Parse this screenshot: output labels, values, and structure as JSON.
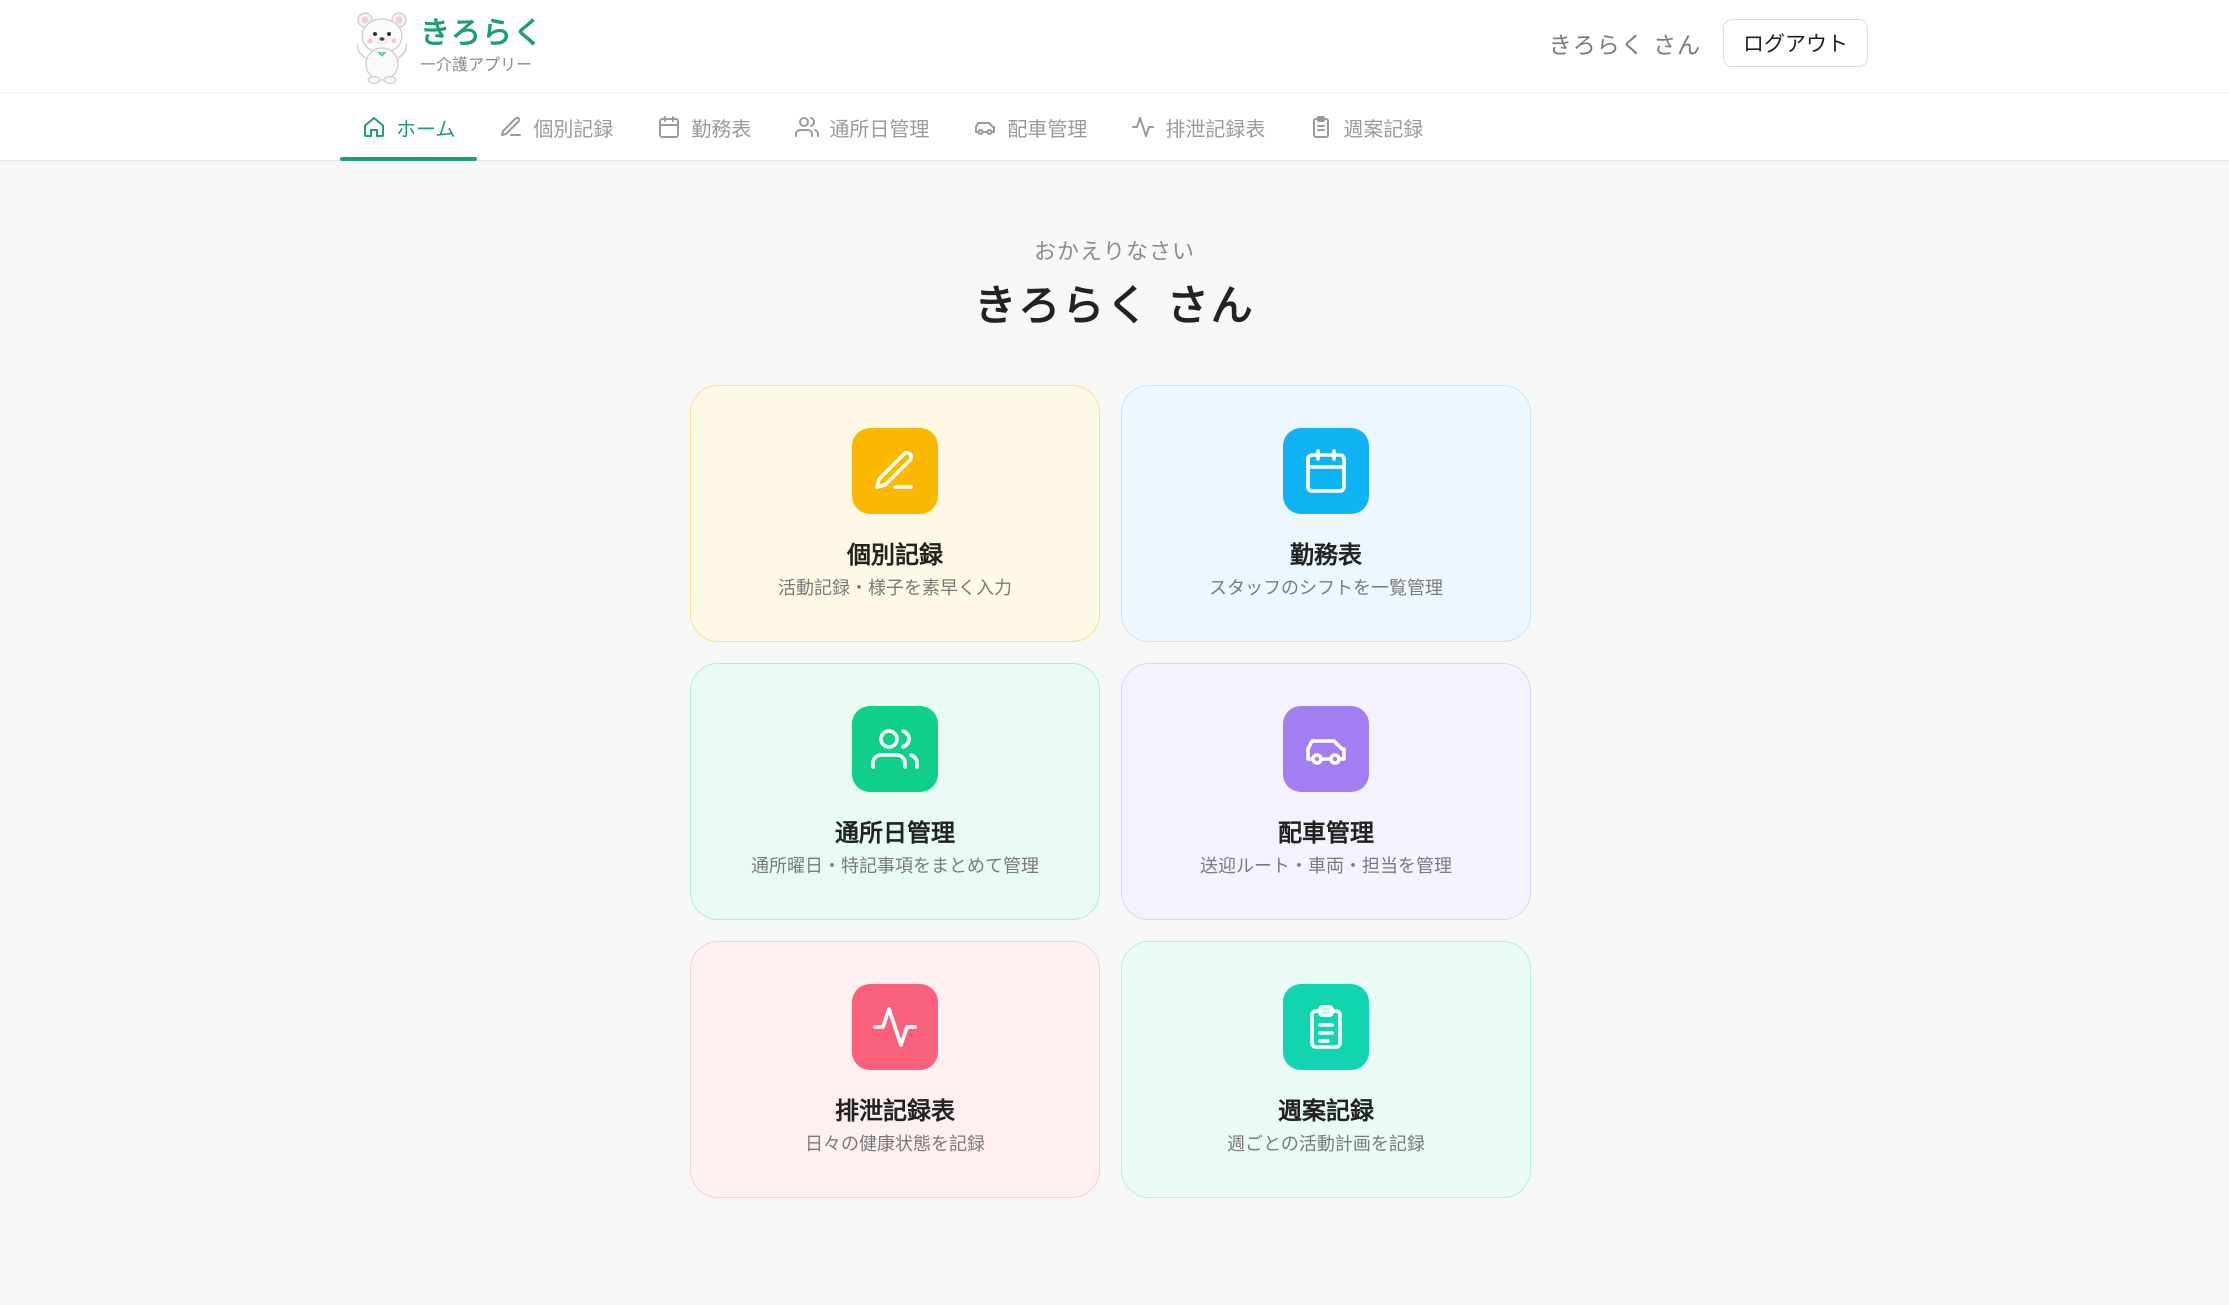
{
  "header": {
    "app_title": "きろらく",
    "app_subtitle": "一介護アプリー",
    "user_name": "きろらく さん",
    "logout_label": "ログアウト"
  },
  "nav": {
    "tabs": [
      {
        "label": "ホーム",
        "icon": "home-icon",
        "active": true
      },
      {
        "label": "個別記録",
        "icon": "pencil-icon",
        "active": false
      },
      {
        "label": "勤務表",
        "icon": "calendar-icon",
        "active": false
      },
      {
        "label": "通所日管理",
        "icon": "users-icon",
        "active": false
      },
      {
        "label": "配車管理",
        "icon": "car-icon",
        "active": false
      },
      {
        "label": "排泄記録表",
        "icon": "activity-icon",
        "active": false
      },
      {
        "label": "週案記録",
        "icon": "clipboard-icon",
        "active": false
      }
    ]
  },
  "main": {
    "greeting_sub": "おかえりなさい",
    "greeting_title": "きろらく さん",
    "cards": [
      {
        "title": "個別記録",
        "desc": "活動記録・様子を素早く入力",
        "icon": "pencil-icon",
        "icon_color": "#fbb800"
      },
      {
        "title": "勤務表",
        "desc": "スタッフのシフトを一覧管理",
        "icon": "calendar-icon",
        "icon_color": "#10b4f4"
      },
      {
        "title": "通所日管理",
        "desc": "通所曜日・特記事項をまとめて管理",
        "icon": "users-icon",
        "icon_color": "#10cf8a"
      },
      {
        "title": "配車管理",
        "desc": "送迎ルート・車両・担当を管理",
        "icon": "car-icon",
        "icon_color": "#a27ef2"
      },
      {
        "title": "排泄記録表",
        "desc": "日々の健康状態を記録",
        "icon": "activity-icon",
        "icon_color": "#f9607c"
      },
      {
        "title": "週案記録",
        "desc": "週ごとの活動計画を記録",
        "icon": "clipboard-icon",
        "icon_color": "#12d4b1"
      }
    ]
  },
  "colors": {
    "accent": "#1e9f6f"
  }
}
